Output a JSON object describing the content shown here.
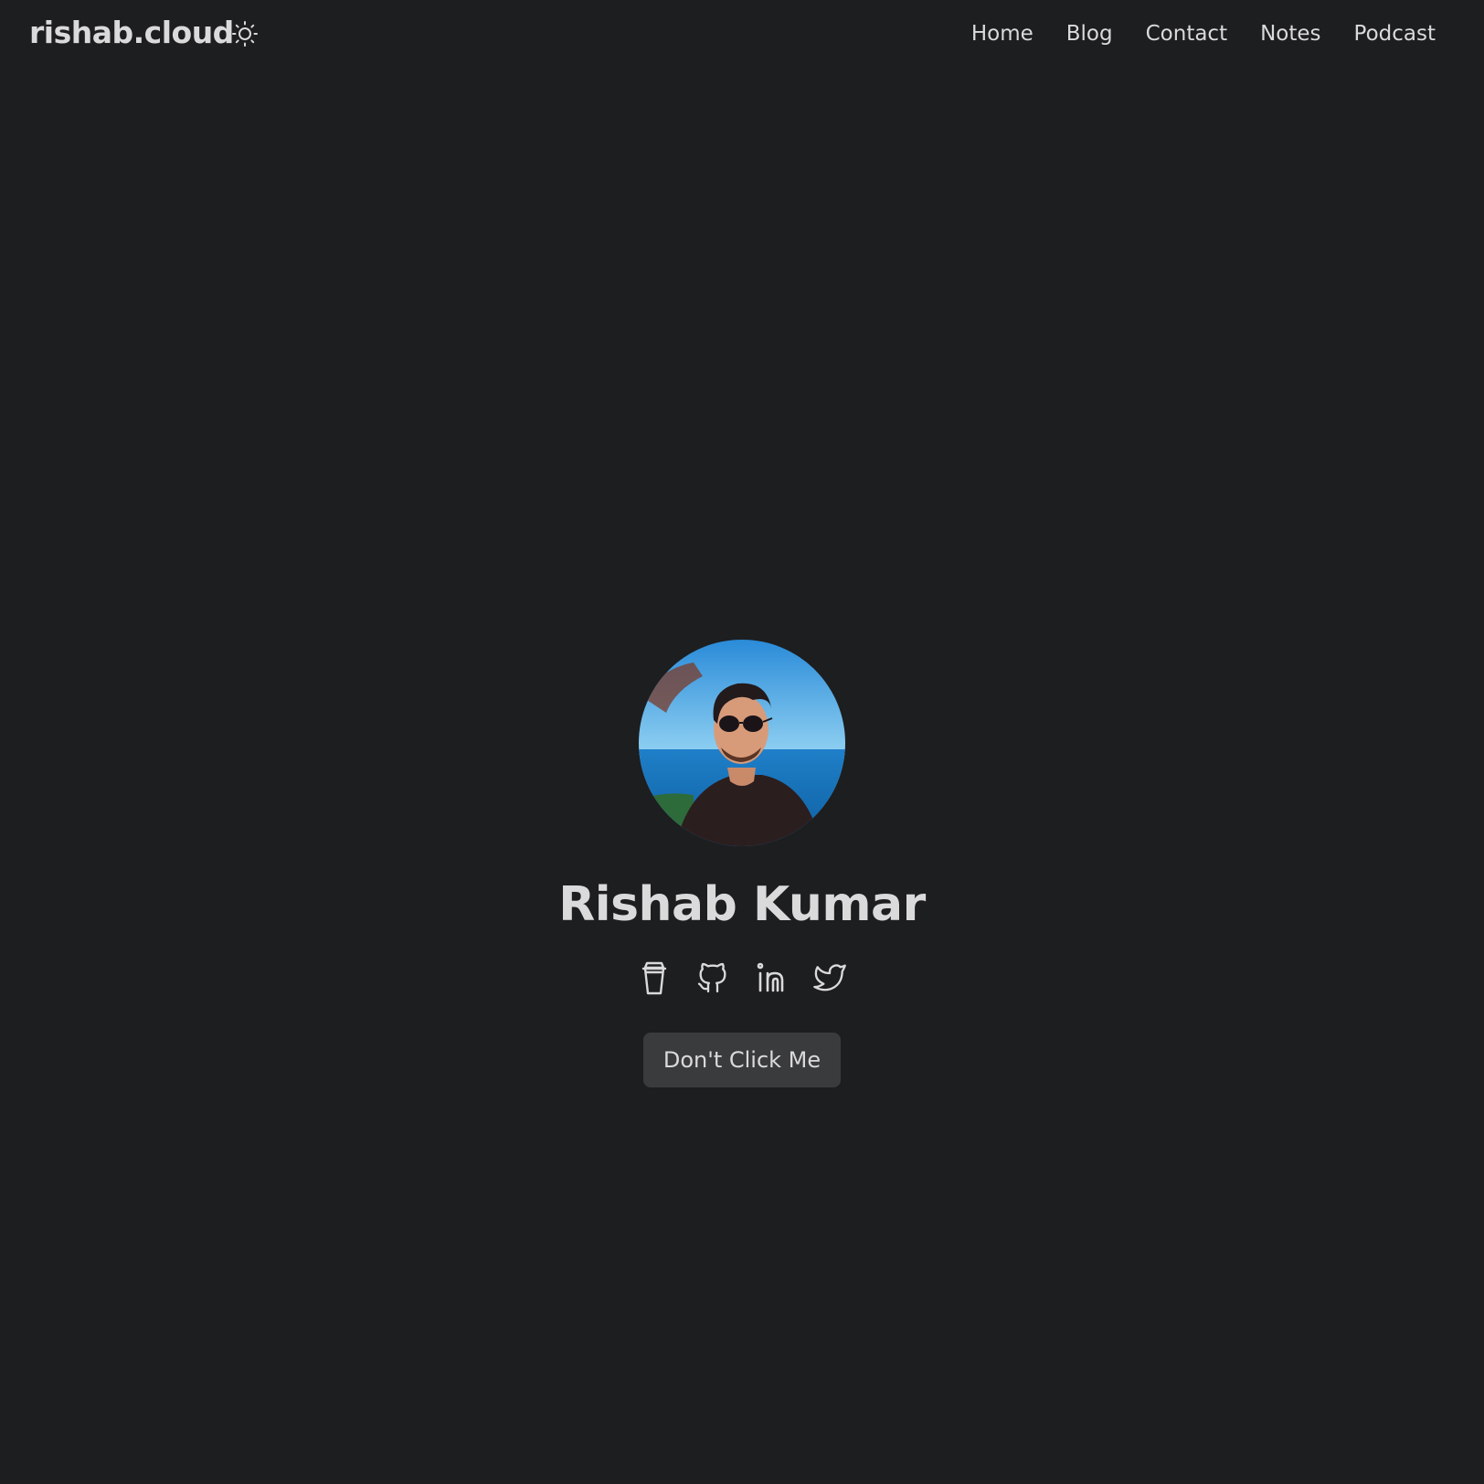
{
  "header": {
    "brand": "rishab.cloud",
    "theme_icon": "sun-icon",
    "nav": [
      {
        "label": "Home"
      },
      {
        "label": "Blog"
      },
      {
        "label": "Contact"
      },
      {
        "label": "Notes"
      },
      {
        "label": "Podcast"
      }
    ]
  },
  "profile": {
    "name": "Rishab Kumar",
    "socials": [
      {
        "icon": "coffee-cup-icon"
      },
      {
        "icon": "github-icon"
      },
      {
        "icon": "linkedin-icon"
      },
      {
        "icon": "twitter-icon"
      }
    ],
    "button_label": "Don't Click Me"
  },
  "colors": {
    "background": "#1d1e20",
    "text": "#dadadb",
    "button_bg": "#3a3b3d"
  }
}
